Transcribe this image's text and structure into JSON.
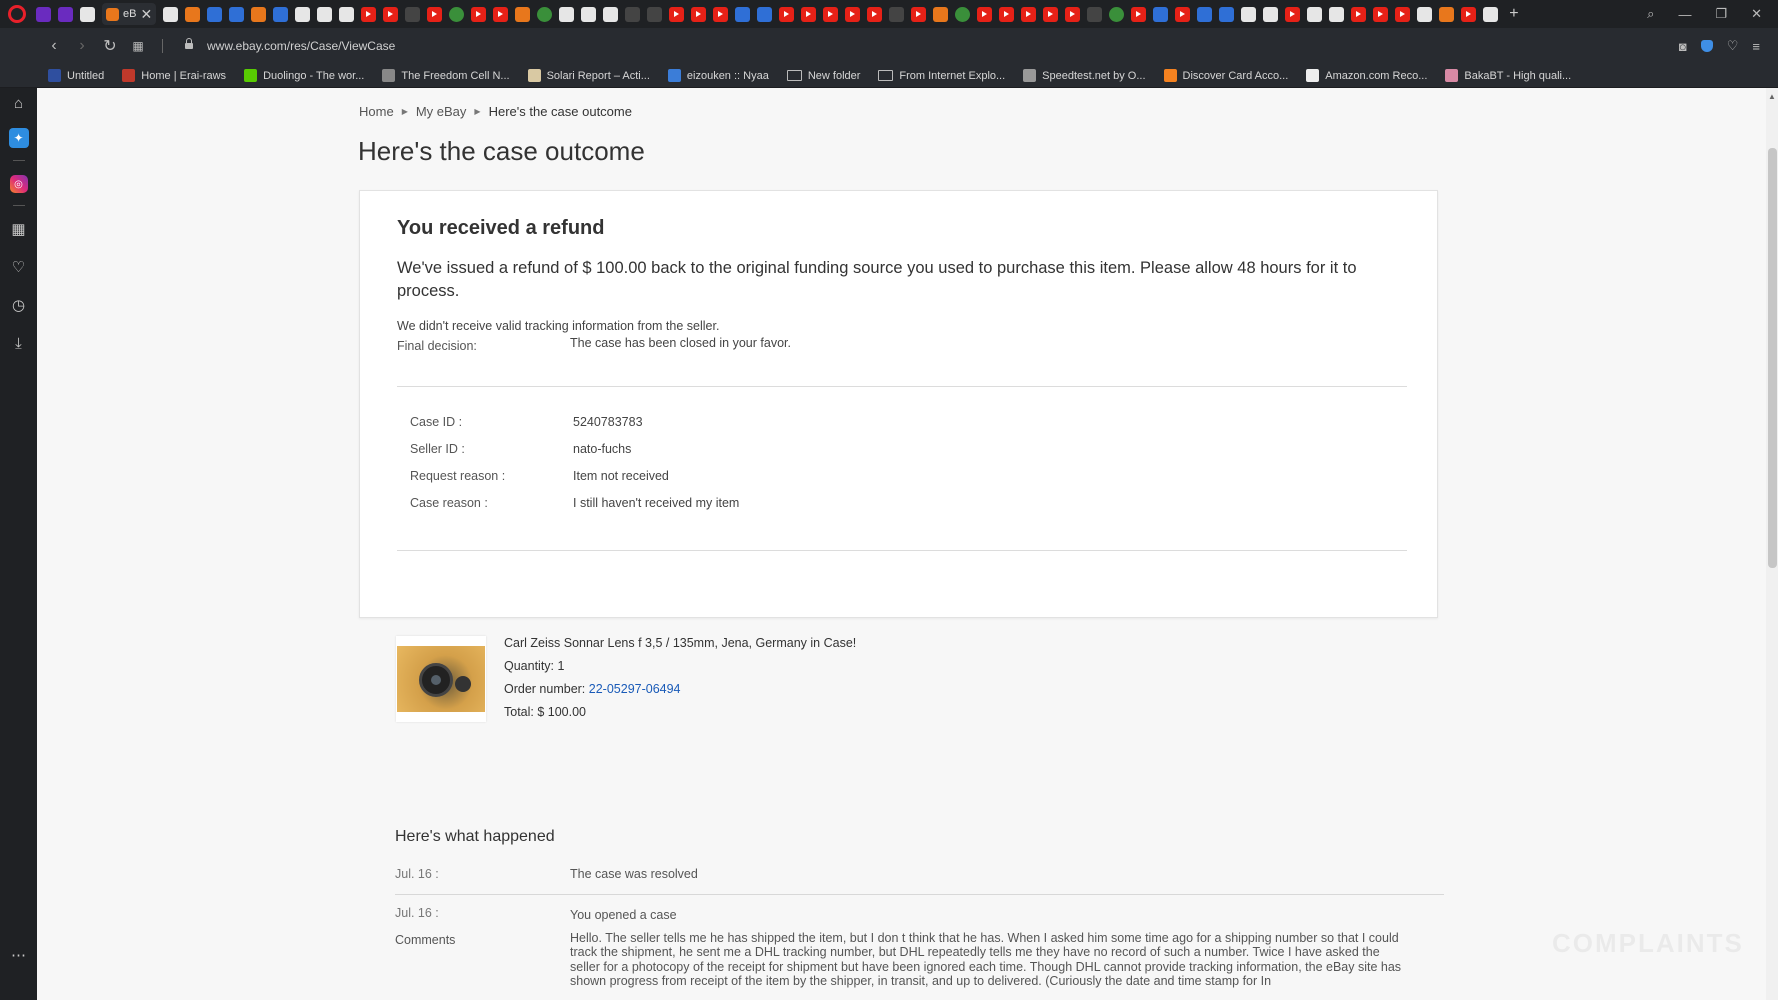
{
  "browser": {
    "active_tab_label": "eB",
    "url": "www.ebay.com/res/Case/ViewCase",
    "bookmarks": [
      {
        "label": "Untitled",
        "color": "#2f4f9f"
      },
      {
        "label": "Home | Erai-raws",
        "color": "#c0392b"
      },
      {
        "label": "Duolingo - The wor...",
        "color": "#58cc02"
      },
      {
        "label": "The Freedom Cell N...",
        "color": "#888888"
      },
      {
        "label": "Solari Report – Acti...",
        "color": "#d9c9a3"
      },
      {
        "label": "eizouken :: Nyaa",
        "color": "#3b7dd8"
      },
      {
        "label": "New folder",
        "color": "folder"
      },
      {
        "label": "From Internet Explo...",
        "color": "folder"
      },
      {
        "label": "Speedtest.net by O...",
        "color": "#999999"
      },
      {
        "label": "Discover Card Acco...",
        "color": "#f58220"
      },
      {
        "label": "Amazon.com Reco...",
        "color": "#eeeeee"
      },
      {
        "label": "BakaBT - High quali...",
        "color": "#d88aa5"
      }
    ]
  },
  "breadcrumb": {
    "home": "Home",
    "my_ebay": "My eBay",
    "current": "Here's the case outcome"
  },
  "page_title": "Here's the case outcome",
  "outcome": {
    "heading": "You received a refund",
    "message": "We've issued a refund of $ 100.00 back to the original funding source you used to purchase this item. Please allow 48 hours for it to process.",
    "tracking_note": "We didn't receive valid tracking information from the seller.",
    "final_decision_label": "Final decision:",
    "final_decision_value": "The case has been closed in your favor."
  },
  "details": [
    {
      "label": "Case ID :",
      "value": "5240783783"
    },
    {
      "label": "Seller ID :",
      "value": "nato-fuchs"
    },
    {
      "label": "Request reason :",
      "value": "Item not received"
    },
    {
      "label": "Case reason :",
      "value": "I still haven't received my item"
    }
  ],
  "item": {
    "title": "Carl Zeiss Sonnar Lens f 3,5 / 135mm, Jena, Germany in Case!",
    "quantity": "Quantity: 1",
    "order_label": "Order number:",
    "order_number": "22-05297-06494",
    "total": "Total: $ 100.00"
  },
  "timeline": {
    "title": "Here's what happened",
    "events": [
      {
        "date": "Jul. 16 :",
        "text": "The case was resolved"
      },
      {
        "date": "Jul. 16 :",
        "text": "You opened a case"
      }
    ],
    "comments_label": "Comments",
    "comments": "Hello. The seller tells me he has shipped the item, but I don t think that he has. When I asked him some time ago for a shipping number so that I could track the shipment, he sent me a DHL tracking number, but DHL repeatedly tells me they have no record of such a number. Twice I have asked the seller for a photocopy of the receipt for shipment but have been ignored each time. Though DHL cannot provide tracking information, the eBay site has shown progress from receipt of the item by the shipper, in transit, and up to delivered. (Curiously the date and time stamp for In"
  },
  "watermark": "COMPLAINTS"
}
